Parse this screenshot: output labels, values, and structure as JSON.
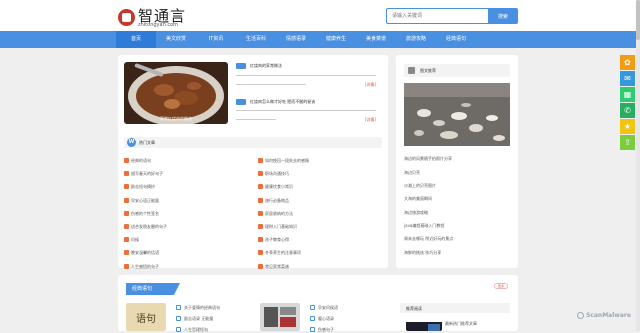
{
  "header": {
    "logo_cn": "智通言",
    "logo_en": "zhitongyan.com",
    "search_placeholder": "请输入关键词",
    "search_button": "搜索"
  },
  "nav": {
    "items": [
      "首页",
      "美文欣赏",
      "IT资讯",
      "生活百科",
      "情感语录",
      "健康养生",
      "美食菜谱",
      "旅游攻略",
      "经典语句"
    ]
  },
  "featured": {
    "image_caption": "家常红烧肉的做法",
    "posts": [
      {
        "tag": "推荐",
        "title": "红烧肉的家常做法",
        "more": "[详情]"
      },
      {
        "tag": "推荐",
        "title": "红烧肉怎么做才好吃 肥而不腻的秘诀",
        "more": "[详情]"
      }
    ]
  },
  "list_section": {
    "title": "热门文章",
    "icon_letter": "W",
    "left": [
      "经典的语句",
      "描写春天的好句子",
      "励志短句摘抄",
      "早安心语正能量",
      "伤感的个性签名",
      "适合发朋友圈的句子",
      "问候",
      "晚安温馨的话语",
      "人生感悟的句子"
    ],
    "right": [
      "如何挽回一段失去的感情",
      "职场沟通技巧",
      "健康饮食小常识",
      "旅行必备物品",
      "家居收纳的方法",
      "理财入门基础知识",
      "孩子教育心得",
      "冬季养生的注意事项",
      "常见家常菜谱"
    ]
  },
  "sidebar": {
    "title": "图文推荐",
    "links": [
      "海边的风景随手拍照片分享",
      "海边贝壳",
      "沙滩上的贝壳图片",
      "大海的美丽瞬间",
      "海边旅游攻略",
      "java编程基础入门教程",
      "周末去哪玩 附近好玩的景点",
      "海鲜的挑选 技巧分享"
    ]
  },
  "bottom": {
    "tab": "经典语句",
    "more": "更多",
    "thumb_caption": "语句",
    "col1": [
      "关于爱情的经典语句",
      "励志语录 正能量",
      "人生哲理短句"
    ],
    "col2": [
      "早安问候语",
      "暖心语录",
      "伤感句子"
    ],
    "side_title": "推荐阅读",
    "side_item": "最新热门推荐文章"
  },
  "share": {
    "colors": [
      "#f39c12",
      "#3498db",
      "#2ecc71",
      "#27ae60",
      "#f1c40f",
      "#7ccd3b"
    ],
    "glyphs": [
      "✿",
      "✉",
      "▦",
      "✆",
      "★",
      "⇪"
    ],
    "icons": [
      "weibo-icon",
      "qq-icon",
      "qzone-icon",
      "wechat-icon",
      "favorite-icon",
      "share-icon"
    ]
  },
  "watermark": "ScanMalware"
}
